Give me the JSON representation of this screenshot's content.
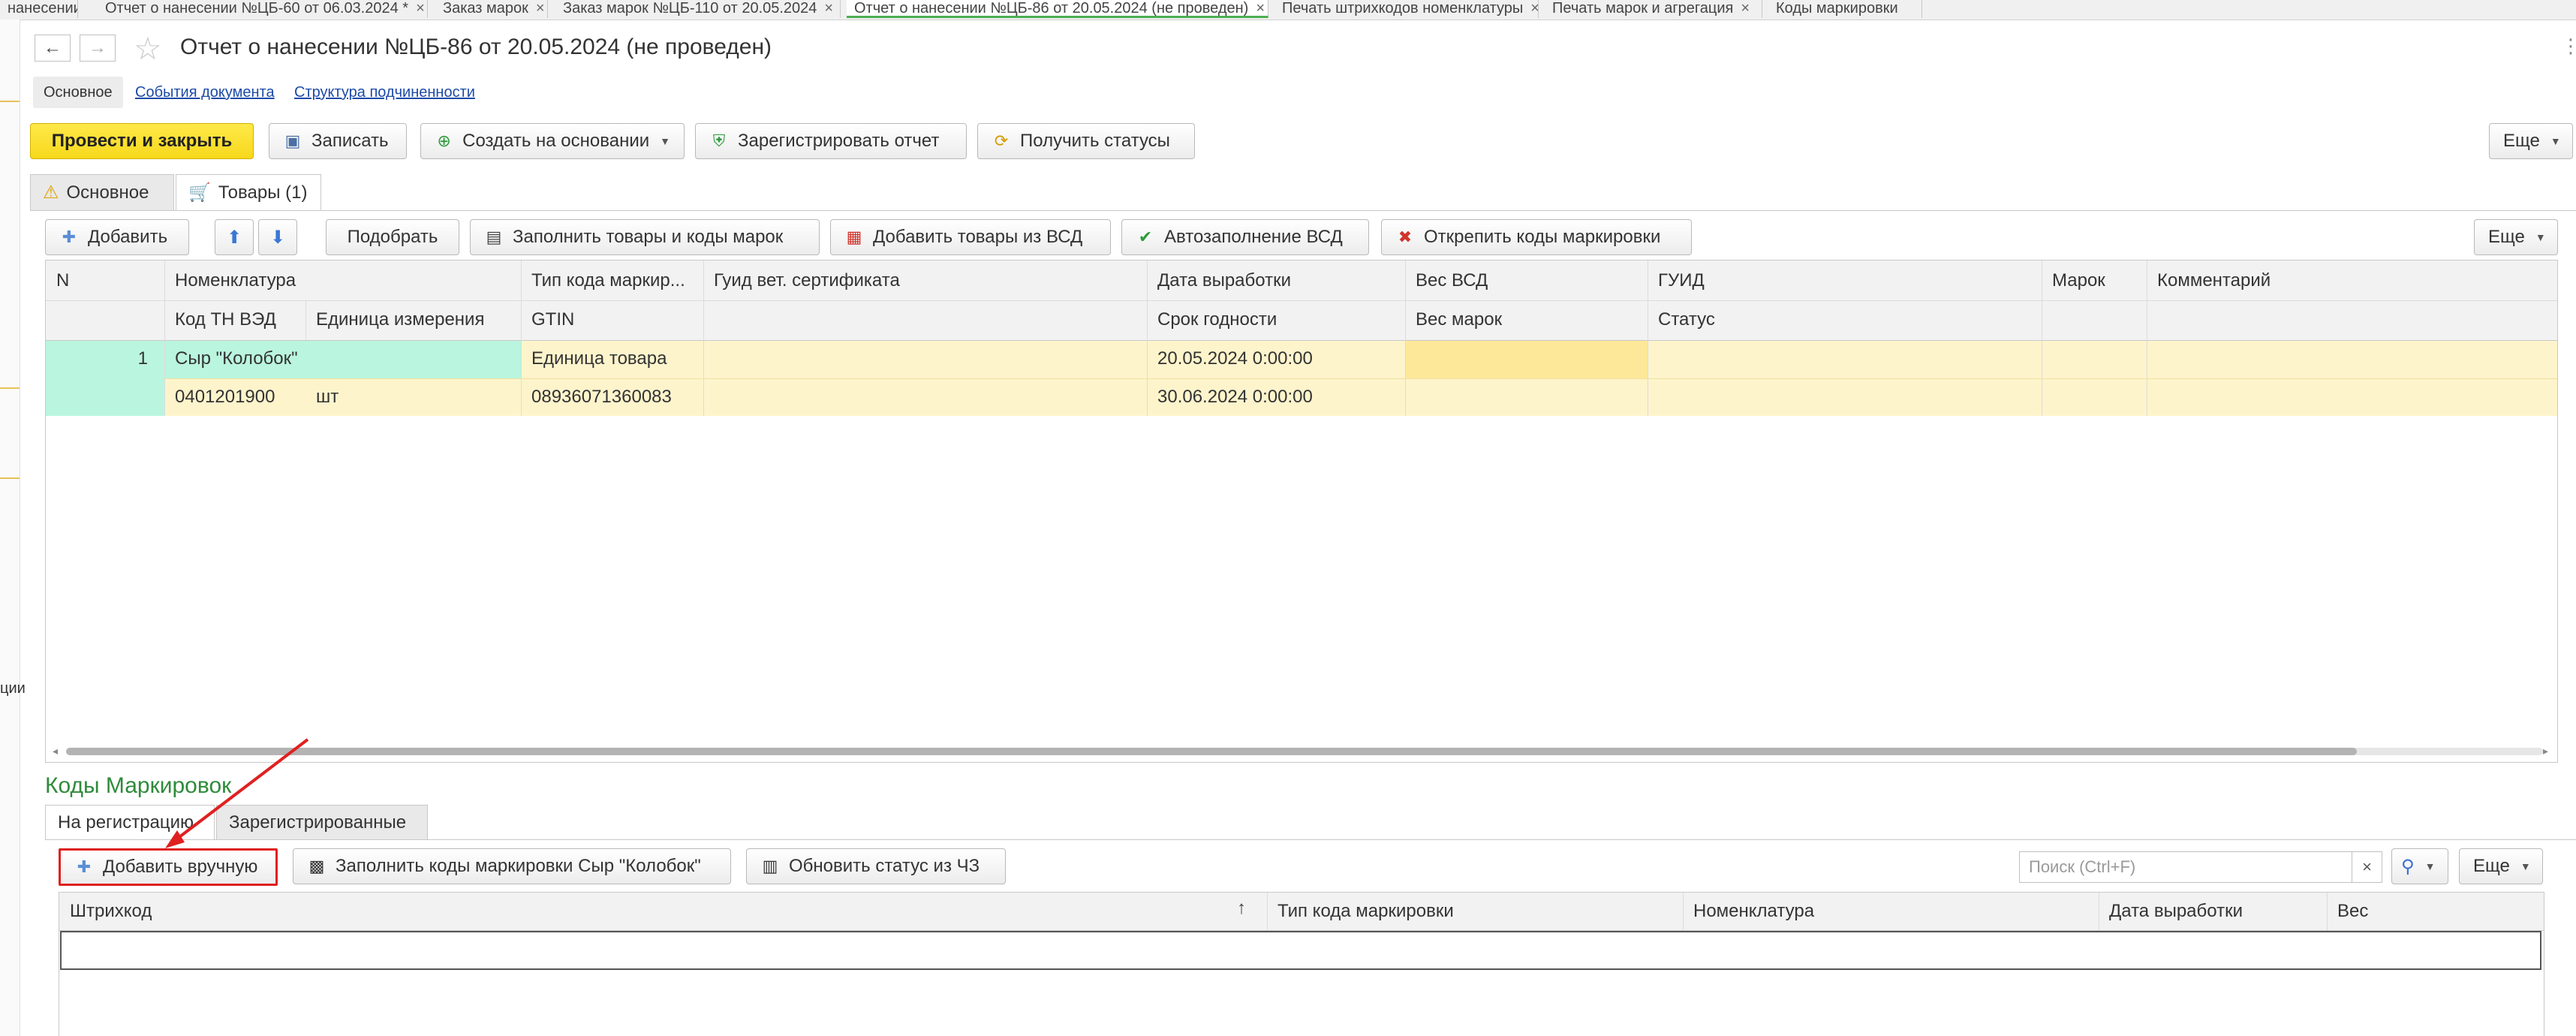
{
  "window_tabs": [
    {
      "label": "нанесении"
    },
    {
      "label": "Отчет о нанесении №ЦБ-60 от 06.03.2024 *"
    },
    {
      "label": "Заказ марок"
    },
    {
      "label": "Заказ марок №ЦБ-110 от 20.05.2024"
    },
    {
      "label": "Отчет о нанесении №ЦБ-86 от 20.05.2024 (не проведен)"
    },
    {
      "label": "Печать штрихкодов номенклатуры"
    },
    {
      "label": "Печать марок и агрегация"
    },
    {
      "label": "Коды маркировки"
    }
  ],
  "left_strip_text": "ции",
  "document_title": "Отчет о нанесении №ЦБ-86 от 20.05.2024 (не проведен)",
  "subnav": {
    "active": "Основное",
    "links": [
      "События документа",
      "Структура подчиненности"
    ]
  },
  "toolbar": {
    "post_close": "Провести и закрыть",
    "save": "Записать",
    "create_based": "Создать на основании",
    "register": "Зарегистрировать отчет",
    "get_statuses": "Получить статусы",
    "more": "Еще"
  },
  "form_tabs": [
    "Основное",
    "Товары (1)"
  ],
  "goods_toolbar": {
    "add": "Добавить",
    "pick": "Подобрать",
    "fill": "Заполнить товары и коды марок",
    "add_vsd": "Добавить товары из ВСД",
    "auto_vsd": "Автозаполнение ВСД",
    "detach": "Открепить коды маркировки",
    "more": "Еще"
  },
  "goods_table": {
    "header_row1": [
      "N",
      "Номенклатура",
      "Тип кода маркир...",
      "Гуид вет. сертификата",
      "Дата выработки",
      "Вес ВСД",
      "ГУИД",
      "Марок",
      "Комментарий"
    ],
    "header_row2": [
      "Код ТН ВЭД",
      "Единица измерения",
      "GTIN",
      "Срок годности",
      "Вес марок",
      "Статус"
    ],
    "row": {
      "n": "1",
      "nomenclature": "Сыр \"Колобок\"",
      "code_type": "Единица товара",
      "prod_date": "20.05.2024 0:00:00",
      "tnved": "0401201900",
      "unit": "шт",
      "gtin": "08936071360083",
      "expiry": "30.06.2024 0:00:00"
    }
  },
  "codes_section_title": "Коды Маркировок",
  "codes_tabs": [
    "На регистрацию",
    "Зарегистрированные"
  ],
  "codes_toolbar": {
    "add_manual": "Добавить вручную",
    "fill_codes": "Заполнить коды маркировки Сыр \"Колобок\"",
    "update_status": "Обновить статус из ЧЗ",
    "search_placeholder": "Поиск (Ctrl+F)",
    "more": "Еще"
  },
  "codes_table_headers": [
    "Штрихкод",
    "Тип кода маркировки",
    "Номенклатура",
    "Дата выработки",
    "Вес"
  ],
  "colors": {
    "accent_yellow": "#f7d81c",
    "row_green": "#baf5df",
    "row_yellow": "#fef4cc",
    "selected_cell": "#fde89a",
    "section_title": "#2e8b3a",
    "annotation_red": "#e02020"
  }
}
